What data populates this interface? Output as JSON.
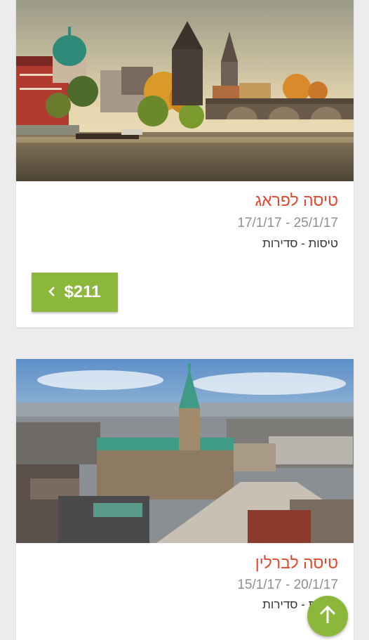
{
  "trips": [
    {
      "title": "טיסה לפראג",
      "dates": "17/1/17 - 25/1/17",
      "categories": "טיסות - סדירות",
      "price": "$211",
      "image": "prague-charles-bridge-photo"
    },
    {
      "title": "טיסה לברלין",
      "dates": "15/1/17 - 20/1/17",
      "categories": "טיסות - סדירות",
      "image": "city-hall-aerial-photo"
    }
  ],
  "icons": {
    "price_chevron": "chevron-left-icon",
    "fab": "arrow-up-icon"
  },
  "colors": {
    "accent": "#8bb83a",
    "title": "#e0492f",
    "background": "#ececec"
  }
}
